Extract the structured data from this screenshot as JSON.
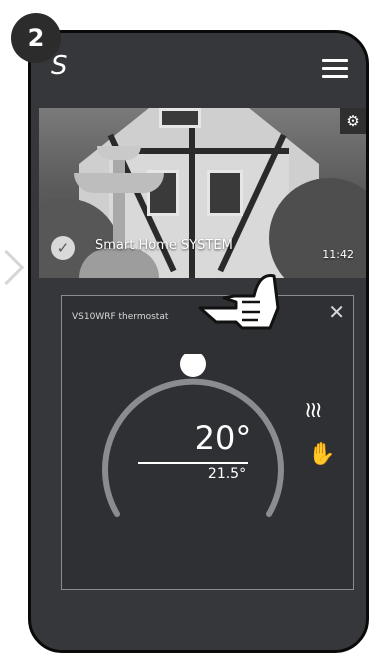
{
  "step": {
    "number": "2"
  },
  "app": {
    "logo": "S",
    "menu_icon": "hamburger-menu-icon"
  },
  "home": {
    "name": "Smart Home SYSTEM",
    "time": "11:42",
    "settings_icon": "gear-icon",
    "selected_icon": "checkmark-icon"
  },
  "device": {
    "name": "VS10WRF thermostat",
    "set_temperature": "20°",
    "current_temperature": "21.5°",
    "set_temperature_value": 20,
    "current_temperature_value": 21.5,
    "mode_icons": [
      "heating-icon",
      "manual-hand-icon"
    ],
    "close_icon": "close-icon"
  },
  "colors": {
    "screen_bg": "#35373b",
    "card_bg": "#2e3034",
    "accent": "#ffffff",
    "dial_track": "#8a8c90"
  }
}
